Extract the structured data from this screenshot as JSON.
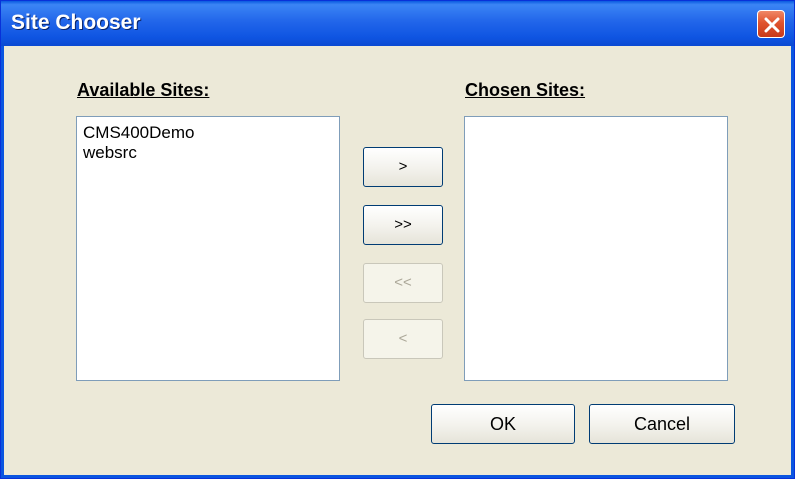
{
  "window": {
    "title": "Site Chooser",
    "close_icon": "close-icon"
  },
  "available": {
    "label": "Available Sites:",
    "items": [
      "CMS400Demo",
      "websrc"
    ]
  },
  "chosen": {
    "label": "Chosen Sites:",
    "items": []
  },
  "move_buttons": {
    "add_one": {
      "label": ">",
      "enabled": true
    },
    "add_all": {
      "label": ">>",
      "enabled": true
    },
    "remove_all": {
      "label": "<<",
      "enabled": false
    },
    "remove_one": {
      "label": "<",
      "enabled": false
    }
  },
  "dialog_buttons": {
    "ok": "OK",
    "cancel": "Cancel"
  },
  "colors": {
    "titlebar": "#2266ea",
    "dialog_bg": "#ece9d8",
    "close_button": "#e0542e"
  }
}
